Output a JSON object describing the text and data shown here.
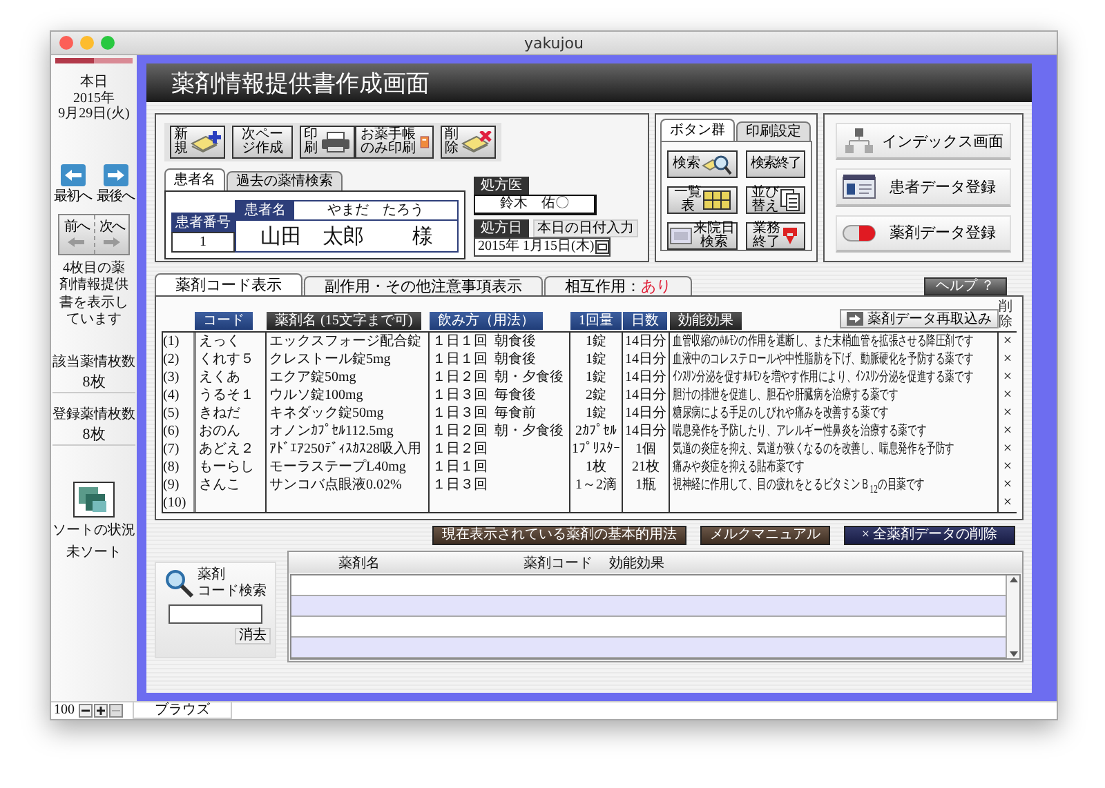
{
  "window": {
    "title": "yakujou"
  },
  "sidebar": {
    "date_label": "本日",
    "year": "2015年",
    "date": "9月29日(火)",
    "nav_buttons": [
      {
        "label": "最初へ",
        "kind": "first"
      },
      {
        "label": "最後へ",
        "kind": "last"
      }
    ],
    "page_turn": [
      {
        "label": "前へ",
        "kind": "prev"
      },
      {
        "label": "次へ",
        "kind": "next"
      }
    ],
    "status_text": "4枚目の薬剤情報提供書を表示しています",
    "counts": [
      {
        "label": "該当薬情枚数",
        "value": "8枚"
      },
      {
        "label": "登録薬情枚数",
        "value": "8枚"
      }
    ],
    "sort": {
      "label": "ソートの状況",
      "value": "未ソート"
    }
  },
  "header": {
    "title": "薬剤情報提供書作成画面"
  },
  "toolbar": [
    {
      "label": "新規",
      "kind": "new"
    },
    {
      "label": "次ページ作成",
      "kind": "text"
    },
    {
      "label": "印刷",
      "kind": "print"
    },
    {
      "label": "お薬手帳のみ印刷",
      "kind": "notebook"
    },
    {
      "label": "削除",
      "kind": "delete"
    }
  ],
  "patient_tabs": [
    {
      "label": "患者名",
      "selected": true
    },
    {
      "label": "過去の薬情検索",
      "selected": false
    }
  ],
  "patient": {
    "number_label": "患者番号",
    "number": "1",
    "name_label": "患者名",
    "furigana": "やまだ　たろう",
    "name": "山田　太郎",
    "honorific": "様"
  },
  "prescriber": {
    "label": "処方医",
    "value": "鈴木　佑〇"
  },
  "prescription_date": {
    "label": "処方日",
    "today_button": "本日の日付入力",
    "value": "2015年 1月15日(木)"
  },
  "panel_tabs": [
    {
      "label": "ボタン群",
      "selected": true
    },
    {
      "label": "印刷設定",
      "selected": false
    }
  ],
  "panel_buttons": [
    {
      "label": "検索",
      "kind": "search"
    },
    {
      "label": "検索終了",
      "kind": "text"
    },
    {
      "label": "一覧表",
      "kind": "list"
    },
    {
      "label": "並び替え",
      "kind": "sort"
    },
    {
      "label": "来院日検索",
      "kind": "calendar"
    },
    {
      "label": "業務終了",
      "kind": "exit"
    }
  ],
  "nav_buttons": [
    {
      "label": "インデックス画面",
      "kind": "index"
    },
    {
      "label": "患者データ登録",
      "kind": "patient"
    },
    {
      "label": "薬剤データ登録",
      "kind": "drug"
    }
  ],
  "drug_tabs": [
    {
      "label": "薬剤コード表示",
      "selected": true
    },
    {
      "label": "副作用・その他注意事項表示",
      "selected": false
    },
    {
      "label": "相互作用：",
      "value": "あり",
      "selected": false
    }
  ],
  "help_button": "ヘルプ ？",
  "reload_button": "薬剤データ再取込み",
  "columns": [
    {
      "label": "コード",
      "kind": "blue"
    },
    {
      "label": "薬剤名",
      "note": "(15文字まで可)",
      "kind": "dark"
    },
    {
      "label": "飲み方（用法）",
      "kind": "blue"
    },
    {
      "label": "1回量",
      "kind": "blue"
    },
    {
      "label": "日数",
      "kind": "blue"
    },
    {
      "label": "効能効果",
      "kind": "dark"
    },
    {
      "label": "削除",
      "kind": "plain"
    }
  ],
  "rows": [
    {
      "number": "(1)",
      "code": "えっく",
      "name": "エックスフォージ配合錠",
      "frequency": "１日１回",
      "timing": "朝食後",
      "amount": "1錠",
      "days": "14日分",
      "effect": "血管収縮のﾎﾙﾓﾝの作用を遮断し、また末梢血管を拡張させる降圧剤です",
      "delete": "×"
    },
    {
      "number": "(2)",
      "code": "くれす５",
      "name": "クレストール錠5mg",
      "frequency": "１日１回",
      "timing": "朝食後",
      "amount": "1錠",
      "days": "14日分",
      "effect": "血液中のコレステロールや中性脂肪を下げ、動脈硬化を予防する薬です",
      "delete": "×"
    },
    {
      "number": "(3)",
      "code": "えくあ",
      "name": "エクア錠50mg",
      "frequency": "１日２回",
      "timing": "朝・夕食後",
      "amount": "1錠",
      "days": "14日分",
      "effect": "ｲﾝｽﾘﾝ分泌を促すﾎﾙﾓﾝを増やす作用により、ｲﾝｽﾘﾝ分泌を促進する薬です",
      "delete": "×"
    },
    {
      "number": "(4)",
      "code": "うるそ１",
      "name": "ウルソ錠100mg",
      "frequency": "１日３回",
      "timing": "毎食後",
      "amount": "2錠",
      "days": "14日分",
      "effect": "胆汁の排泄を促進し、胆石や肝臓病を治療する薬です",
      "delete": "×"
    },
    {
      "number": "(5)",
      "code": "きねだ",
      "name": "キネダック錠50mg",
      "frequency": "１日３回",
      "timing": "毎食前",
      "amount": "1錠",
      "days": "14日分",
      "effect": "糖尿病による手足のしびれや痛みを改善する薬です",
      "delete": "×"
    },
    {
      "number": "(6)",
      "code": "おのん",
      "name": "オノンｶﾌﾟｾﾙ112.5mg",
      "frequency": "１日２回",
      "timing": "朝・夕食後",
      "amount": "2ｶﾌﾟｾﾙ",
      "days": "14日分",
      "effect": "喘息発作を予防したり、アレルギー性鼻炎を治療する薬です",
      "delete": "×"
    },
    {
      "number": "(7)",
      "code": "あどえ２",
      "name": "ｱﾄﾞｴｱ250ﾃﾞｨｽｶｽ28吸入用",
      "frequency": "１日２回",
      "amount": "1ﾌﾟﾘｽﾀｰ",
      "days": "1個",
      "effect": "気道の炎症を抑え、気道が狭くなるのを改善し、喘息発作を予防す",
      "delete": "×"
    },
    {
      "number": "(8)",
      "code": "もーらし",
      "name": "モーラステープL40mg",
      "frequency": "１日１回",
      "amount": "1枚",
      "days": "21枚",
      "effect": "痛みや炎症を抑える貼布薬です",
      "delete": "×"
    },
    {
      "number": "(9)",
      "code": "さんこ",
      "name": "サンコバ点眼液0.02%",
      "frequency": "１日３回",
      "amount": "1～2滴",
      "days": "1瓶",
      "effect": "視神経に作用して、目の疲れをとるビタミンＢ$_{12}$の目薬です",
      "delete": "×"
    },
    {
      "number": "(10)",
      "delete": "×"
    }
  ],
  "action_buttons": [
    {
      "label": "現在表示されている薬剤の基本的用法",
      "kind": "brown"
    },
    {
      "label": "メルクマニュアル",
      "kind": "brown"
    },
    {
      "label": "× 全薬剤データの削除",
      "kind": "navy"
    }
  ],
  "code_search": {
    "title": "薬剤",
    "subtitle": "コード検索",
    "clear_button": "消去"
  },
  "results": {
    "columns": [
      "薬剤名",
      "薬剤コード",
      "効能効果"
    ]
  },
  "status_bar": {
    "zoom": "100",
    "mode": "ブラウズ"
  }
}
